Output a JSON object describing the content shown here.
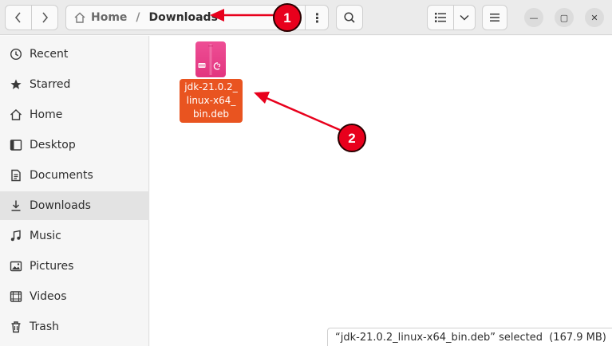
{
  "header": {
    "path_home": "Home",
    "path_separator": "/",
    "path_current": "Downloads",
    "menu_glyph": "⋮",
    "win_min_glyph": "—",
    "win_max_glyph": "▢",
    "win_close_glyph": "✕"
  },
  "sidebar": {
    "items": [
      {
        "label": "Recent",
        "icon": "clock-icon"
      },
      {
        "label": "Starred",
        "icon": "star-icon"
      },
      {
        "label": "Home",
        "icon": "home-icon"
      },
      {
        "label": "Desktop",
        "icon": "desktop-icon"
      },
      {
        "label": "Documents",
        "icon": "document-icon"
      },
      {
        "label": "Downloads",
        "icon": "download-icon",
        "active": true
      },
      {
        "label": "Music",
        "icon": "music-icon"
      },
      {
        "label": "Pictures",
        "icon": "picture-icon"
      },
      {
        "label": "Videos",
        "icon": "video-icon"
      },
      {
        "label": "Trash",
        "icon": "trash-icon"
      }
    ]
  },
  "files": [
    {
      "name_lines": [
        "jdk-21.0.2_",
        "linux-x64_",
        "bin.deb"
      ],
      "icon": "deb-package-icon",
      "selected": true
    }
  ],
  "status": {
    "text": "“jdk-21.0.2_linux-x64_bin.deb” selected  (167.9 MB)"
  },
  "annotations": [
    {
      "label": "1"
    },
    {
      "label": "2"
    }
  ],
  "colors": {
    "accent": "#e95420",
    "annotation": "#e8001c",
    "package_pink": "#e2357f"
  }
}
